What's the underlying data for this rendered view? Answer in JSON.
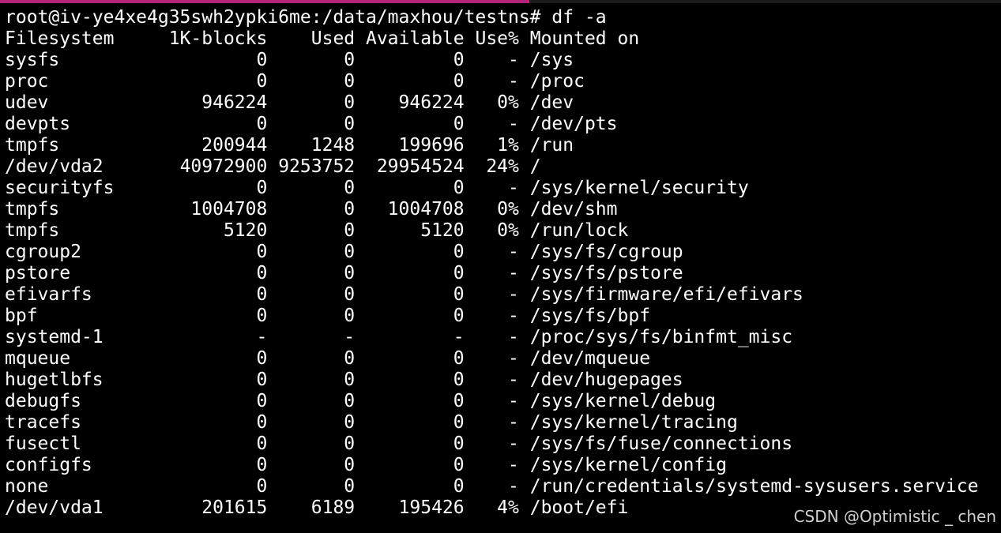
{
  "colors": {
    "background": "#000000",
    "text": "#ffffff",
    "tab_accent": "#b3247a",
    "watermark": "#cfcfcf"
  },
  "terminal": {
    "prompt": "root@iv-ye4xe4g35swh2ypki6me:/data/maxhou/testns#",
    "command": "df -a",
    "header": {
      "filesystem": "Filesystem",
      "blocks": "1K-blocks",
      "used": "Used",
      "available": "Available",
      "use_pct": "Use%",
      "mounted_on": "Mounted on"
    },
    "rows": [
      {
        "filesystem": "sysfs",
        "blocks": "0",
        "used": "0",
        "available": "0",
        "use_pct": "-",
        "mounted_on": "/sys"
      },
      {
        "filesystem": "proc",
        "blocks": "0",
        "used": "0",
        "available": "0",
        "use_pct": "-",
        "mounted_on": "/proc"
      },
      {
        "filesystem": "udev",
        "blocks": "946224",
        "used": "0",
        "available": "946224",
        "use_pct": "0%",
        "mounted_on": "/dev"
      },
      {
        "filesystem": "devpts",
        "blocks": "0",
        "used": "0",
        "available": "0",
        "use_pct": "-",
        "mounted_on": "/dev/pts"
      },
      {
        "filesystem": "tmpfs",
        "blocks": "200944",
        "used": "1248",
        "available": "199696",
        "use_pct": "1%",
        "mounted_on": "/run"
      },
      {
        "filesystem": "/dev/vda2",
        "blocks": "40972900",
        "used": "9253752",
        "available": "29954524",
        "use_pct": "24%",
        "mounted_on": "/"
      },
      {
        "filesystem": "securityfs",
        "blocks": "0",
        "used": "0",
        "available": "0",
        "use_pct": "-",
        "mounted_on": "/sys/kernel/security"
      },
      {
        "filesystem": "tmpfs",
        "blocks": "1004708",
        "used": "0",
        "available": "1004708",
        "use_pct": "0%",
        "mounted_on": "/dev/shm"
      },
      {
        "filesystem": "tmpfs",
        "blocks": "5120",
        "used": "0",
        "available": "5120",
        "use_pct": "0%",
        "mounted_on": "/run/lock"
      },
      {
        "filesystem": "cgroup2",
        "blocks": "0",
        "used": "0",
        "available": "0",
        "use_pct": "-",
        "mounted_on": "/sys/fs/cgroup"
      },
      {
        "filesystem": "pstore",
        "blocks": "0",
        "used": "0",
        "available": "0",
        "use_pct": "-",
        "mounted_on": "/sys/fs/pstore"
      },
      {
        "filesystem": "efivarfs",
        "blocks": "0",
        "used": "0",
        "available": "0",
        "use_pct": "-",
        "mounted_on": "/sys/firmware/efi/efivars"
      },
      {
        "filesystem": "bpf",
        "blocks": "0",
        "used": "0",
        "available": "0",
        "use_pct": "-",
        "mounted_on": "/sys/fs/bpf"
      },
      {
        "filesystem": "systemd-1",
        "blocks": "-",
        "used": "-",
        "available": "-",
        "use_pct": "-",
        "mounted_on": "/proc/sys/fs/binfmt_misc"
      },
      {
        "filesystem": "mqueue",
        "blocks": "0",
        "used": "0",
        "available": "0",
        "use_pct": "-",
        "mounted_on": "/dev/mqueue"
      },
      {
        "filesystem": "hugetlbfs",
        "blocks": "0",
        "used": "0",
        "available": "0",
        "use_pct": "-",
        "mounted_on": "/dev/hugepages"
      },
      {
        "filesystem": "debugfs",
        "blocks": "0",
        "used": "0",
        "available": "0",
        "use_pct": "-",
        "mounted_on": "/sys/kernel/debug"
      },
      {
        "filesystem": "tracefs",
        "blocks": "0",
        "used": "0",
        "available": "0",
        "use_pct": "-",
        "mounted_on": "/sys/kernel/tracing"
      },
      {
        "filesystem": "fusectl",
        "blocks": "0",
        "used": "0",
        "available": "0",
        "use_pct": "-",
        "mounted_on": "/sys/fs/fuse/connections"
      },
      {
        "filesystem": "configfs",
        "blocks": "0",
        "used": "0",
        "available": "0",
        "use_pct": "-",
        "mounted_on": "/sys/kernel/config"
      },
      {
        "filesystem": "none",
        "blocks": "0",
        "used": "0",
        "available": "0",
        "use_pct": "-",
        "mounted_on": "/run/credentials/systemd-sysusers.service"
      },
      {
        "filesystem": "/dev/vda1",
        "blocks": "201615",
        "used": "6189",
        "available": "195426",
        "use_pct": "4%",
        "mounted_on": "/boot/efi"
      }
    ]
  },
  "watermark": "CSDN @Optimistic _ chen"
}
